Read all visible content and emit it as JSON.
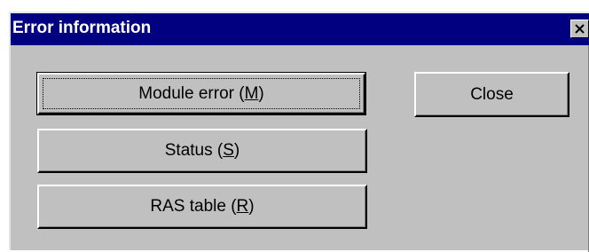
{
  "window": {
    "title": "Error information"
  },
  "buttons": {
    "module_error": {
      "label": "Module error (",
      "mnemonic": "M",
      "suffix": ")"
    },
    "status": {
      "label": "Status (",
      "mnemonic": "S",
      "suffix": ")"
    },
    "ras_table": {
      "label": "RAS table (",
      "mnemonic": "R",
      "suffix": ")"
    },
    "close": {
      "label": "Close"
    }
  },
  "icons": {
    "titlebar_close": "close-icon"
  },
  "colors": {
    "titlebar": "#000080",
    "face": "#c0c0c0"
  }
}
